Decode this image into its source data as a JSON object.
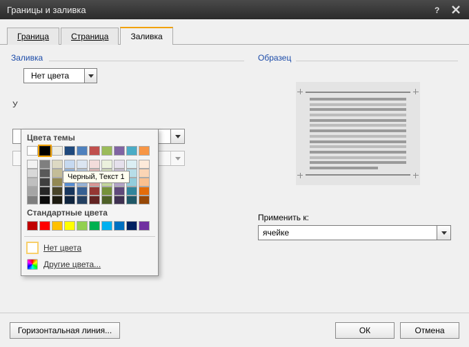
{
  "window": {
    "title": "Границы и заливка"
  },
  "tabs": {
    "border": "Граница",
    "page": "Страница",
    "fill": "Заливка",
    "active": "fill"
  },
  "fill_group": {
    "label": "Заливка",
    "combo_value": "Нет цвета",
    "pattern_label_prefix": "У"
  },
  "preview_group": {
    "label": "Образец",
    "apply_label": "Применить к:",
    "apply_value": "ячейке"
  },
  "color_popup": {
    "theme_header": "Цвета темы",
    "standard_header": "Стандартные цвета",
    "no_color": "Нет цвета",
    "more_colors": "Другие цвета...",
    "tooltip": "Черный, Текст 1",
    "theme_row1": [
      "#ffffff",
      "#000000",
      "#eeece1",
      "#1f497d",
      "#4f81bd",
      "#c0504d",
      "#9bbb59",
      "#8064a2",
      "#4bacc6",
      "#f79646"
    ],
    "theme_tints": [
      [
        "#f2f2f2",
        "#7f7f7f",
        "#ddd9c3",
        "#c6d9f0",
        "#dbe5f1",
        "#f2dcdb",
        "#ebf1dd",
        "#e5e0ec",
        "#dbeef3",
        "#fdeada"
      ],
      [
        "#d8d8d8",
        "#595959",
        "#c4bd97",
        "#8db3e2",
        "#b8cce4",
        "#e5b9b7",
        "#d7e3bc",
        "#ccc1d9",
        "#b7dde8",
        "#fbd5b5"
      ],
      [
        "#bfbfbf",
        "#3f3f3f",
        "#938953",
        "#548dd4",
        "#95b3d7",
        "#d99694",
        "#c3d69b",
        "#b2a2c7",
        "#92cddc",
        "#fac08f"
      ],
      [
        "#a5a5a5",
        "#262626",
        "#494429",
        "#17365d",
        "#366092",
        "#953734",
        "#76923c",
        "#5f497a",
        "#31859b",
        "#e36c09"
      ],
      [
        "#7f7f7f",
        "#0c0c0c",
        "#1d1b10",
        "#0f243e",
        "#244061",
        "#632423",
        "#4f6128",
        "#3f3151",
        "#205867",
        "#974806"
      ]
    ],
    "standard": [
      "#c00000",
      "#ff0000",
      "#ffc000",
      "#ffff00",
      "#92d050",
      "#00b050",
      "#00b0f0",
      "#0070c0",
      "#002060",
      "#7030a0"
    ]
  },
  "footer": {
    "hline": "Горизонтальная линия...",
    "ok": "ОК",
    "cancel": "Отмена"
  }
}
